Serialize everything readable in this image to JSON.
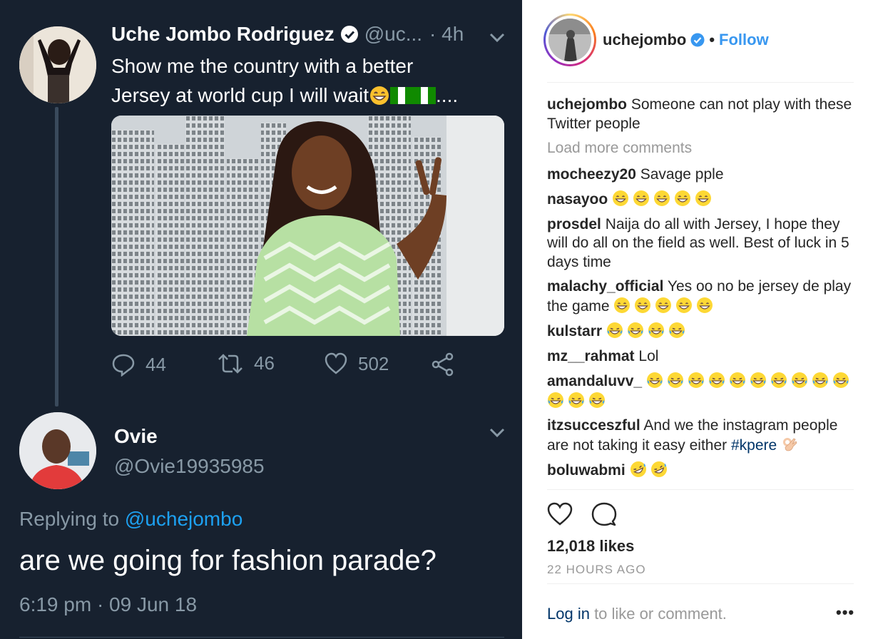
{
  "tweet": {
    "name": "Uche Jombo Rodriguez",
    "handle": "@uc...",
    "time": "· 4h",
    "text_line1": "Show me the country with a better",
    "text_line2": "Jersey at world cup I will wait",
    "text_tail": "....",
    "emoji": [
      "grinning-face",
      "nigeria-flag",
      "nigeria-flag"
    ],
    "replies": "44",
    "retweets": "46",
    "likes": "502"
  },
  "reply": {
    "name": "Ovie",
    "handle": "@Ovie19935985",
    "replying_prefix": "Replying to",
    "replying_to": "@uchejombo",
    "text": "are we going for fashion parade?",
    "timestamp": "6:19 pm · 09 Jun 18"
  },
  "instagram": {
    "username": "uchejombo",
    "follow_label": "Follow",
    "dot": "•",
    "caption_user": "uchejombo",
    "caption_text": "Someone can not play with these Twitter people",
    "load_more": "Load more comments",
    "comments": [
      {
        "user": "mocheezy20",
        "text": "Savage pple",
        "emoji": []
      },
      {
        "user": "nasayoo",
        "text": "",
        "emoji": [
          "grin",
          "grin",
          "grin",
          "grin",
          "grin"
        ]
      },
      {
        "user": "prosdel",
        "text": "Naija do all with Jersey, I hope they will do all on the field as well. Best of luck in 5 days time",
        "emoji": []
      },
      {
        "user": "malachy_official",
        "text": "Yes oo no be jersey de play the game",
        "emoji": [
          "grin",
          "grin",
          "grin",
          "grin",
          "grin"
        ]
      },
      {
        "user": "kulstarr",
        "text": "",
        "emoji": [
          "joy",
          "joy",
          "joy",
          "joy"
        ]
      },
      {
        "user": "mz__rahmat",
        "text": "Lol",
        "emoji": []
      },
      {
        "user": "amandaluvv_",
        "text": "",
        "emoji": [
          "joy",
          "joy",
          "joy",
          "joy",
          "joy",
          "joy",
          "joy",
          "joy",
          "joy",
          "joy",
          "joy",
          "joy",
          "joy"
        ]
      },
      {
        "user": "itzsucceszful",
        "text": "And we the instagram people are not taking it easy either",
        "tag": "#kpere",
        "emoji": [
          "ok-hand"
        ]
      },
      {
        "user": "boluwabmi",
        "text": "",
        "emoji": [
          "rofl",
          "rofl"
        ]
      }
    ],
    "likes": "12,018 likes",
    "time_ago": "22 HOURS AGO",
    "login_link": "Log in",
    "login_rest": " to like or comment.",
    "more": "•••",
    "colors": {
      "link": "#3897f0",
      "tag": "#003569",
      "muted": "#999999"
    }
  },
  "colors": {
    "twitter_bg": "#17212f",
    "twitter_muted": "#8899a6",
    "twitter_blue": "#1da1f2"
  }
}
